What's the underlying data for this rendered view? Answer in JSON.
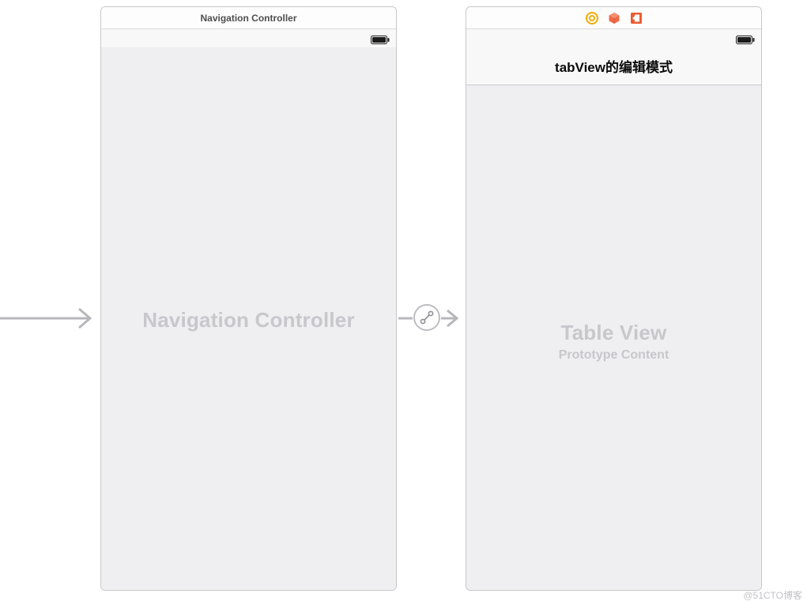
{
  "left_scene": {
    "title": "Navigation Controller",
    "placeholder": "Navigation Controller"
  },
  "right_scene": {
    "nav_title": "tabView的编辑模式",
    "placeholder_title": "Table View",
    "placeholder_sub": "Prototype Content"
  },
  "watermark": "@51CTO博客"
}
